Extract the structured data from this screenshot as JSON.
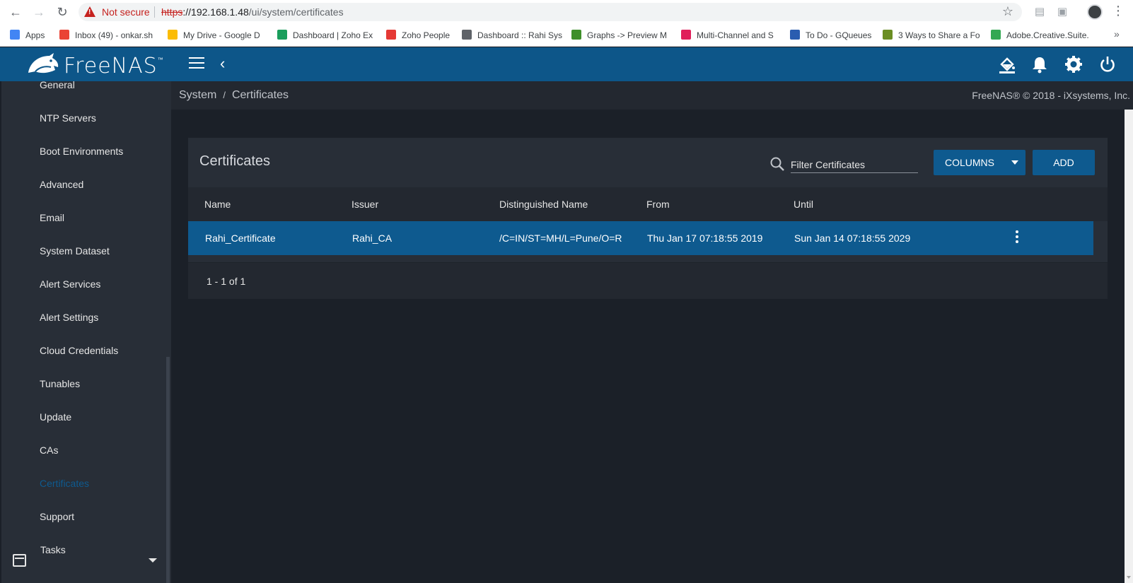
{
  "browser": {
    "security_label": "Not secure",
    "url_scheme": "https",
    "url_host": "://192.168.1.48",
    "url_path": "/ui/system/certificates",
    "bookmarks": [
      {
        "label": "Apps",
        "color": "#4285f4"
      },
      {
        "label": "Inbox (49) - onkar.sh",
        "color": "#ea4335"
      },
      {
        "label": "My Drive - Google D",
        "color": "#fbbc04"
      },
      {
        "label": "Dashboard | Zoho Ex",
        "color": "#1a9e5c"
      },
      {
        "label": "Zoho People",
        "color": "#e53935"
      },
      {
        "label": "Dashboard :: Rahi Sys",
        "color": "#5f6368"
      },
      {
        "label": "Graphs -> Preview M",
        "color": "#3f8f2a"
      },
      {
        "label": "Multi-Channel and S",
        "color": "#e01e5a"
      },
      {
        "label": "To Do - GQueues",
        "color": "#2a5db0"
      },
      {
        "label": "3 Ways to Share a Fo",
        "color": "#6b8e23"
      },
      {
        "label": "Adobe.Creative.Suite.",
        "color": "#34a853"
      }
    ],
    "more_label": "»"
  },
  "app": {
    "logo_text": "FreeNAS",
    "logo_tm": "™",
    "back_glyph": "‹"
  },
  "sidebar": {
    "items": [
      {
        "label": "General"
      },
      {
        "label": "NTP Servers"
      },
      {
        "label": "Boot Environments"
      },
      {
        "label": "Advanced"
      },
      {
        "label": "Email"
      },
      {
        "label": "System Dataset"
      },
      {
        "label": "Alert Services"
      },
      {
        "label": "Alert Settings"
      },
      {
        "label": "Cloud Credentials"
      },
      {
        "label": "Tunables"
      },
      {
        "label": "Update"
      },
      {
        "label": "CAs"
      },
      {
        "label": "Certificates"
      },
      {
        "label": "Support"
      },
      {
        "label": "Tasks"
      }
    ],
    "active": "Certificates",
    "active_color": "#0e5a8f"
  },
  "breadcrumb": {
    "parent": "System",
    "separator": "/",
    "current": "Certificates"
  },
  "copyright": "FreeNAS® © 2018 - iXsystems, Inc.",
  "card": {
    "title": "Certificates",
    "filter_placeholder": "Filter Certificates",
    "columns_label": "COLUMNS",
    "add_label": "ADD"
  },
  "table": {
    "columns": [
      "Name",
      "Issuer",
      "Distinguished Name",
      "From",
      "Until"
    ],
    "rows": [
      [
        "Rahi_Certificate",
        "Rahi_CA",
        "/C=IN/ST=MH/L=Pune/O=R",
        "Thu Jan 17 07:18:55 2019",
        "Sun Jan 14 07:18:55 2029"
      ]
    ],
    "pager": "1 - 1 of 1"
  },
  "colors": {
    "brand": "#0d5689",
    "accent": "#0e5a8f",
    "sidebar_bg": "#282e37",
    "page_bg": "#1b2028"
  }
}
